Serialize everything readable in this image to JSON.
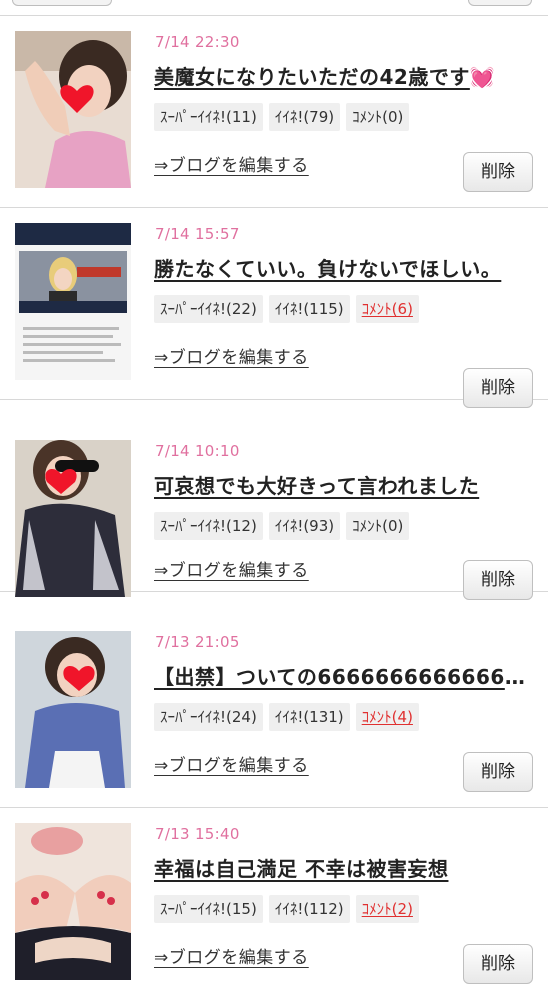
{
  "posts": [
    {
      "date": "7/14 22:30",
      "title": "美魔女になりたいただの42歳です",
      "title_emoji": "💓",
      "super_like": "ｽｰﾊﾟｰｲｲﾈ!(11)",
      "like": "ｲｲﾈ!(79)",
      "comment": "ｺﾒﾝﾄ(0)",
      "comment_has": false,
      "thumb_icon": "heart-sticker",
      "accent": "#e0709f"
    },
    {
      "date": "7/14 15:57",
      "title": "勝たなくていい。負けないでほしい。",
      "title_emoji": "",
      "super_like": "ｽｰﾊﾟｰｲｲﾈ!(22)",
      "like": "ｲｲﾈ!(115)",
      "comment": "ｺﾒﾝﾄ(6)",
      "comment_has": true,
      "thumb_icon": "article-screenshot",
      "thumb_banner": "【ryuchellなぜ】りゅうちぇるが自殺!?",
      "accent": "#e0709f"
    },
    {
      "date": "7/14 10:10",
      "title": "可哀想でも大好きって言われました",
      "title_emoji": "",
      "super_like": "ｽｰﾊﾟｰｲｲﾈ!(12)",
      "like": "ｲｲﾈ!(93)",
      "comment": "ｺﾒﾝﾄ(0)",
      "comment_has": false,
      "thumb_icon": "heart-sticker",
      "accent": "#e0709f"
    },
    {
      "date": "7/13 21:05",
      "title": "【出禁】ついての6666666666666666…",
      "title_emoji": "",
      "super_like": "ｽｰﾊﾟｰｲｲﾈ!(24)",
      "like": "ｲｲﾈ!(131)",
      "comment": "ｺﾒﾝﾄ(4)",
      "comment_has": true,
      "thumb_icon": "heart-sticker",
      "accent": "#e0709f"
    },
    {
      "date": "7/13 15:40",
      "title": "幸福は自己満足 不幸は被害妄想",
      "title_emoji": "",
      "super_like": "ｽｰﾊﾟｰｲｲﾈ!(15)",
      "like": "ｲｲﾈ!(112)",
      "comment": "ｺﾒﾝﾄ(2)",
      "comment_has": true,
      "thumb_icon": "photo",
      "accent": "#e0709f"
    }
  ],
  "edit_label": "⇒ブログを編集する",
  "delete_label": "削除",
  "colors": {
    "date": "#e0709f",
    "comment_active": "#e03030",
    "tag_bg": "#efefef",
    "divider": "#d8d8d8"
  }
}
